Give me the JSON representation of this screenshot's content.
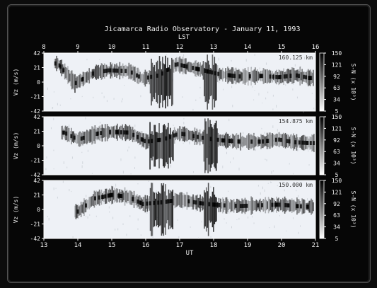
{
  "chart_data": {
    "type": "heatmap",
    "title": "Jicamarca Radio Observatory - January 11, 1993",
    "top_axis": {
      "label": "LST",
      "ticks": [
        "8",
        "9",
        "10",
        "11",
        "12",
        "13",
        "14",
        "15",
        "16"
      ],
      "range": [
        8,
        16
      ]
    },
    "bottom_axis": {
      "label": "UT",
      "ticks": [
        "13",
        "14",
        "15",
        "16",
        "17",
        "18",
        "19",
        "20",
        "21"
      ],
      "range": [
        13,
        21
      ]
    },
    "y_axis": {
      "label": "Vz (m/s)",
      "ticks": [
        "42",
        "21",
        "0",
        "-21",
        "-42"
      ],
      "range": [
        -42,
        42
      ]
    },
    "colorbar": {
      "label": "S-N (x 10³)",
      "ticks": [
        "150",
        "121",
        "92",
        "63",
        "34",
        "5"
      ],
      "range": [
        5,
        150
      ],
      "scale": "grayscale, white = low, black = high"
    },
    "panels": [
      {
        "altitude": "160.125 km",
        "ridge": [
          [
            13.4,
            27
          ],
          [
            13.9,
            -2
          ],
          [
            14.5,
            14
          ],
          [
            14.9,
            17
          ],
          [
            15.5,
            16
          ],
          [
            15.9,
            5
          ],
          [
            16.4,
            10
          ],
          [
            16.9,
            26
          ],
          [
            17.6,
            18
          ],
          [
            18.2,
            11
          ],
          [
            18.8,
            8
          ],
          [
            19.4,
            9
          ],
          [
            19.9,
            7
          ],
          [
            20.4,
            10
          ],
          [
            20.8,
            6
          ]
        ]
      },
      {
        "altitude": "154.875 km",
        "ridge": [
          [
            13.6,
            19
          ],
          [
            14.0,
            9
          ],
          [
            14.6,
            18
          ],
          [
            15.0,
            20
          ],
          [
            15.5,
            19
          ],
          [
            16.0,
            6
          ],
          [
            16.5,
            9
          ],
          [
            17.0,
            18
          ],
          [
            17.6,
            12
          ],
          [
            18.2,
            8
          ],
          [
            18.8,
            6
          ],
          [
            19.4,
            6
          ],
          [
            19.9,
            9
          ],
          [
            20.4,
            5
          ],
          [
            20.8,
            4
          ]
        ]
      },
      {
        "altitude": "150.000 km",
        "ridge": [
          [
            14.0,
            -3
          ],
          [
            14.5,
            16
          ],
          [
            15.0,
            21
          ],
          [
            15.5,
            18
          ],
          [
            15.9,
            8
          ],
          [
            16.4,
            10
          ],
          [
            17.0,
            14
          ],
          [
            17.6,
            9
          ],
          [
            18.2,
            6
          ],
          [
            18.8,
            5
          ],
          [
            19.4,
            6
          ],
          [
            19.9,
            7
          ],
          [
            20.4,
            5
          ],
          [
            20.8,
            4
          ]
        ]
      }
    ]
  }
}
